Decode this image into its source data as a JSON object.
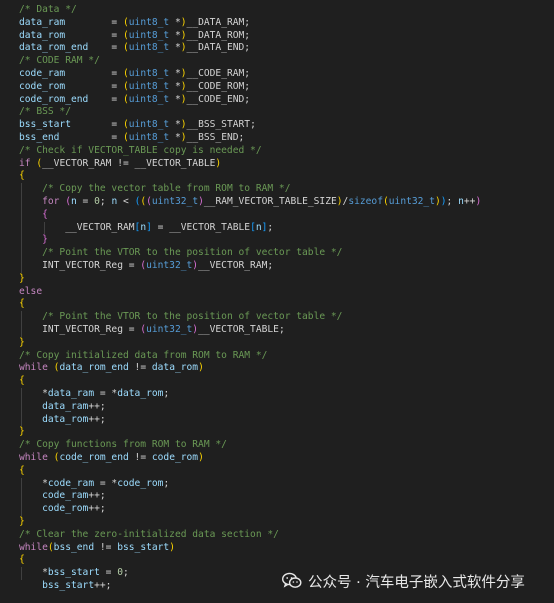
{
  "editor": {
    "lines": [
      [
        [
          "c",
          "/* Data */"
        ]
      ],
      [
        [
          "v",
          "data_ram"
        ],
        [
          "p",
          "        = "
        ],
        [
          "b1",
          "("
        ],
        [
          "ty",
          "uint8_t"
        ],
        [
          "p",
          " *"
        ],
        [
          "b1",
          ")"
        ],
        [
          "p",
          "__DATA_RAM;"
        ]
      ],
      [
        [
          "v",
          "data_rom"
        ],
        [
          "p",
          "        = "
        ],
        [
          "b1",
          "("
        ],
        [
          "ty",
          "uint8_t"
        ],
        [
          "p",
          " *"
        ],
        [
          "b1",
          ")"
        ],
        [
          "p",
          "__DATA_ROM;"
        ]
      ],
      [
        [
          "v",
          "data_rom_end"
        ],
        [
          "p",
          "    = "
        ],
        [
          "b1",
          "("
        ],
        [
          "ty",
          "uint8_t"
        ],
        [
          "p",
          " *"
        ],
        [
          "b1",
          ")"
        ],
        [
          "p",
          "__DATA_END;"
        ]
      ],
      [
        [
          "c",
          "/* CODE RAM */"
        ]
      ],
      [
        [
          "v",
          "code_ram"
        ],
        [
          "p",
          "        = "
        ],
        [
          "b1",
          "("
        ],
        [
          "ty",
          "uint8_t"
        ],
        [
          "p",
          " *"
        ],
        [
          "b1",
          ")"
        ],
        [
          "p",
          "__CODE_RAM;"
        ]
      ],
      [
        [
          "v",
          "code_rom"
        ],
        [
          "p",
          "        = "
        ],
        [
          "b1",
          "("
        ],
        [
          "ty",
          "uint8_t"
        ],
        [
          "p",
          " *"
        ],
        [
          "b1",
          ")"
        ],
        [
          "p",
          "__CODE_ROM;"
        ]
      ],
      [
        [
          "v",
          "code_rom_end"
        ],
        [
          "p",
          "    = "
        ],
        [
          "b1",
          "("
        ],
        [
          "ty",
          "uint8_t"
        ],
        [
          "p",
          " *"
        ],
        [
          "b1",
          ")"
        ],
        [
          "p",
          "__CODE_END;"
        ]
      ],
      [
        [
          "c",
          "/* BSS */"
        ]
      ],
      [
        [
          "v",
          "bss_start"
        ],
        [
          "p",
          "       = "
        ],
        [
          "b1",
          "("
        ],
        [
          "ty",
          "uint8_t"
        ],
        [
          "p",
          " *"
        ],
        [
          "b1",
          ")"
        ],
        [
          "p",
          "__BSS_START;"
        ]
      ],
      [
        [
          "v",
          "bss_end"
        ],
        [
          "p",
          "         = "
        ],
        [
          "b1",
          "("
        ],
        [
          "ty",
          "uint8_t"
        ],
        [
          "p",
          " *"
        ],
        [
          "b1",
          ")"
        ],
        [
          "p",
          "__BSS_END;"
        ]
      ],
      [
        [
          "c",
          "/* Check if VECTOR_TABLE copy is needed */"
        ]
      ],
      [
        [
          "k",
          "if"
        ],
        [
          "p",
          " "
        ],
        [
          "b1",
          "("
        ],
        [
          "p",
          "__VECTOR_RAM != __VECTOR_TABLE"
        ],
        [
          "b1",
          ")"
        ]
      ],
      [
        [
          "b1",
          "{"
        ]
      ],
      [
        [
          "p",
          "    "
        ],
        [
          "c",
          "/* Copy the vector table from ROM to RAM */"
        ]
      ],
      [
        [
          "p",
          "    "
        ],
        [
          "k",
          "for"
        ],
        [
          "p",
          " "
        ],
        [
          "b2",
          "("
        ],
        [
          "v",
          "n"
        ],
        [
          "p",
          " = "
        ],
        [
          "n",
          "0"
        ],
        [
          "p",
          "; "
        ],
        [
          "v",
          "n"
        ],
        [
          "p",
          " < "
        ],
        [
          "b3",
          "("
        ],
        [
          "b1",
          "("
        ],
        [
          "b2",
          "("
        ],
        [
          "ty",
          "uint32_t"
        ],
        [
          "b2",
          ")"
        ],
        [
          "p",
          "__RAM_VECTOR_TABLE_SIZE"
        ],
        [
          "b1",
          ")"
        ],
        [
          "p",
          "/"
        ],
        [
          "ty",
          "sizeof"
        ],
        [
          "b1",
          "("
        ],
        [
          "ty",
          "uint32_t"
        ],
        [
          "b1",
          ")"
        ],
        [
          "b3",
          ")"
        ],
        [
          "p",
          "; "
        ],
        [
          "v",
          "n"
        ],
        [
          "p",
          "++"
        ],
        [
          "b2",
          ")"
        ]
      ],
      [
        [
          "p",
          "    "
        ],
        [
          "b2",
          "{"
        ]
      ],
      [
        [
          "p",
          "        __VECTOR_RAM"
        ],
        [
          "b3",
          "["
        ],
        [
          "v",
          "n"
        ],
        [
          "b3",
          "]"
        ],
        [
          "p",
          " = __VECTOR_TABLE"
        ],
        [
          "b3",
          "["
        ],
        [
          "v",
          "n"
        ],
        [
          "b3",
          "]"
        ],
        [
          "p",
          ";"
        ]
      ],
      [
        [
          "p",
          "    "
        ],
        [
          "b2",
          "}"
        ]
      ],
      [
        [
          "p",
          "    "
        ],
        [
          "c",
          "/* Point the VTOR to the position of vector table */"
        ]
      ],
      [
        [
          "p",
          "    INT_VECTOR_Reg = "
        ],
        [
          "b2",
          "("
        ],
        [
          "ty",
          "uint32_t"
        ],
        [
          "b2",
          ")"
        ],
        [
          "p",
          "__VECTOR_RAM;"
        ]
      ],
      [
        [
          "b1",
          "}"
        ]
      ],
      [
        [
          "k",
          "else"
        ]
      ],
      [
        [
          "b1",
          "{"
        ]
      ],
      [
        [
          "p",
          "    "
        ],
        [
          "c",
          "/* Point the VTOR to the position of vector table */"
        ]
      ],
      [
        [
          "p",
          "    INT_VECTOR_Reg = "
        ],
        [
          "b2",
          "("
        ],
        [
          "ty",
          "uint32_t"
        ],
        [
          "b2",
          ")"
        ],
        [
          "p",
          "__VECTOR_TABLE;"
        ]
      ],
      [
        [
          "b1",
          "}"
        ]
      ],
      [
        [
          "c",
          "/* Copy initialized data from ROM to RAM */"
        ]
      ],
      [
        [
          "k",
          "while"
        ],
        [
          "p",
          " "
        ],
        [
          "b1",
          "("
        ],
        [
          "v",
          "data_rom_end"
        ],
        [
          "p",
          " != "
        ],
        [
          "v",
          "data_rom"
        ],
        [
          "b1",
          ")"
        ]
      ],
      [
        [
          "b1",
          "{"
        ]
      ],
      [
        [
          "p",
          "    *"
        ],
        [
          "v",
          "data_ram"
        ],
        [
          "p",
          " = *"
        ],
        [
          "v",
          "data_rom"
        ],
        [
          "p",
          ";"
        ]
      ],
      [
        [
          "p",
          "    "
        ],
        [
          "v",
          "data_ram"
        ],
        [
          "p",
          "++;"
        ]
      ],
      [
        [
          "p",
          "    "
        ],
        [
          "v",
          "data_rom"
        ],
        [
          "p",
          "++;"
        ]
      ],
      [
        [
          "b1",
          "}"
        ]
      ],
      [
        [
          "c",
          "/* Copy functions from ROM to RAM */"
        ]
      ],
      [
        [
          "k",
          "while"
        ],
        [
          "p",
          " "
        ],
        [
          "b1",
          "("
        ],
        [
          "v",
          "code_rom_end"
        ],
        [
          "p",
          " != "
        ],
        [
          "v",
          "code_rom"
        ],
        [
          "b1",
          ")"
        ]
      ],
      [
        [
          "b1",
          "{"
        ]
      ],
      [
        [
          "p",
          "    *"
        ],
        [
          "v",
          "code_ram"
        ],
        [
          "p",
          " = *"
        ],
        [
          "v",
          "code_rom"
        ],
        [
          "p",
          ";"
        ]
      ],
      [
        [
          "p",
          "    "
        ],
        [
          "v",
          "code_ram"
        ],
        [
          "p",
          "++;"
        ]
      ],
      [
        [
          "p",
          "    "
        ],
        [
          "v",
          "code_rom"
        ],
        [
          "p",
          "++;"
        ]
      ],
      [
        [
          "b1",
          "}"
        ]
      ],
      [
        [
          "c",
          "/* Clear the zero-initialized data section */"
        ]
      ],
      [
        [
          "k",
          "while"
        ],
        [
          "b1",
          "("
        ],
        [
          "v",
          "bss_end"
        ],
        [
          "p",
          " != "
        ],
        [
          "v",
          "bss_start"
        ],
        [
          "b1",
          ")"
        ]
      ],
      [
        [
          "b1",
          "{"
        ]
      ],
      [
        [
          "p",
          "    *"
        ],
        [
          "v",
          "bss_start"
        ],
        [
          "p",
          " = "
        ],
        [
          "n",
          "0"
        ],
        [
          "p",
          ";"
        ]
      ],
      [
        [
          "p",
          "    "
        ],
        [
          "v",
          "bss_start"
        ],
        [
          "p",
          "++;"
        ]
      ]
    ]
  },
  "watermark": {
    "text": "公众号 · 汽车电子嵌入式软件分享",
    "icon": "wechat-icon"
  }
}
